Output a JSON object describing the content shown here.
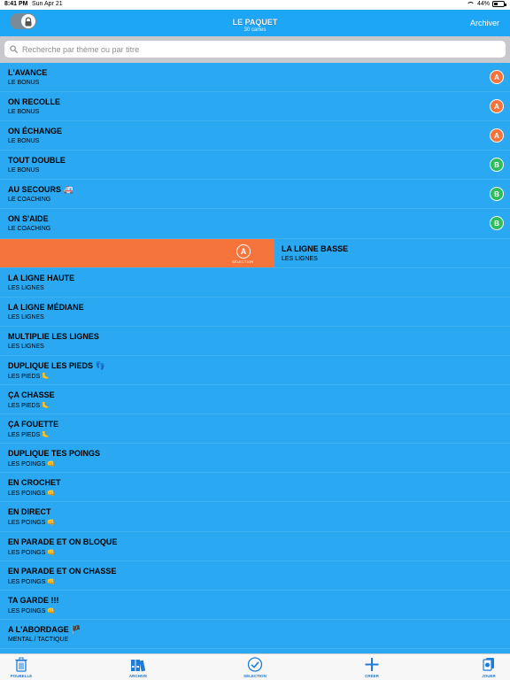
{
  "status": {
    "time": "8:41 PM",
    "date": "Sun Apr 21",
    "battery": "44%",
    "battery_level": 0.44
  },
  "nav": {
    "title": "LE PAQUET",
    "subtitle": "30 cartes",
    "archive_label": "Archiver"
  },
  "search": {
    "placeholder": "Recherche par thème ou par titre",
    "value": ""
  },
  "rows": [
    {
      "title": "L'AVANCE",
      "subtitle": "LE BONUS",
      "badge": "A",
      "badge_color": "#f4743c"
    },
    {
      "title": "ON RECOLLE",
      "subtitle": "LE BONUS",
      "badge": "A",
      "badge_color": "#f4743c"
    },
    {
      "title": "ON ÉCHANGE",
      "subtitle": "LE BONUS",
      "badge": "A",
      "badge_color": "#f4743c"
    },
    {
      "title": "TOUT DOUBLE",
      "subtitle": "LE BONUS",
      "badge": "B",
      "badge_color": "#2dbd5a"
    },
    {
      "title": "AU SECOURS 🚑",
      "subtitle": "LE COACHING",
      "badge": "B",
      "badge_color": "#2dbd5a"
    },
    {
      "title": "ON S'AIDE",
      "subtitle": "LE COACHING",
      "badge": "B",
      "badge_color": "#2dbd5a"
    },
    {
      "title": "LA LIGNE BASSE",
      "subtitle": "LES LIGNES",
      "swipe_action": {
        "icon": "A",
        "label": "SÉLECTION"
      }
    },
    {
      "title": "LA LIGNE HAUTE",
      "subtitle": "LES LIGNES"
    },
    {
      "title": "LA LIGNE MÉDIANE",
      "subtitle": "LES LIGNES"
    },
    {
      "title": "MULTIPLIE LES LIGNES",
      "subtitle": "LES LIGNES"
    },
    {
      "title": "DUPLIQUE LES PIEDS 👣",
      "subtitle": "LES PIEDS 🦶"
    },
    {
      "title": "ÇA CHASSE",
      "subtitle": "LES PIEDS 🦶"
    },
    {
      "title": "ÇA FOUETTE",
      "subtitle": "LES PIEDS 🦶"
    },
    {
      "title": "DUPLIQUE TES POINGS",
      "subtitle": "LES POINGS 👊"
    },
    {
      "title": "EN CROCHET",
      "subtitle": "LES POINGS 👊"
    },
    {
      "title": "EN DIRECT",
      "subtitle": "LES POINGS 👊"
    },
    {
      "title": "EN PARADE ET ON BLOQUE",
      "subtitle": "LES POINGS 👊"
    },
    {
      "title": "EN PARADE ET ON CHASSE",
      "subtitle": "LES POINGS 👊"
    },
    {
      "title": "TA GARDE !!!",
      "subtitle": "LES POINGS 👊"
    },
    {
      "title": "A L'ABORDAGE 🏴",
      "subtitle": "MENTAL / TACTIQUE"
    }
  ],
  "tabs": [
    {
      "label": "POUBELLE",
      "icon": "trash-icon"
    },
    {
      "label": "ARCHIVE",
      "icon": "binders-icon"
    },
    {
      "label": "SÉLECTION",
      "icon": "checkmark-circle-icon"
    },
    {
      "label": "CRÉER",
      "icon": "plus-icon"
    },
    {
      "label": "JOUER",
      "icon": "play-cards-icon"
    }
  ],
  "colors": {
    "list_bg": "#2aa8f2",
    "nav_bg": "#1ea6f6",
    "badge_a": "#f4743c",
    "badge_b": "#2dbd5a",
    "swipe_bg": "#f4743c",
    "tab_tint": "#1e7cd8"
  }
}
